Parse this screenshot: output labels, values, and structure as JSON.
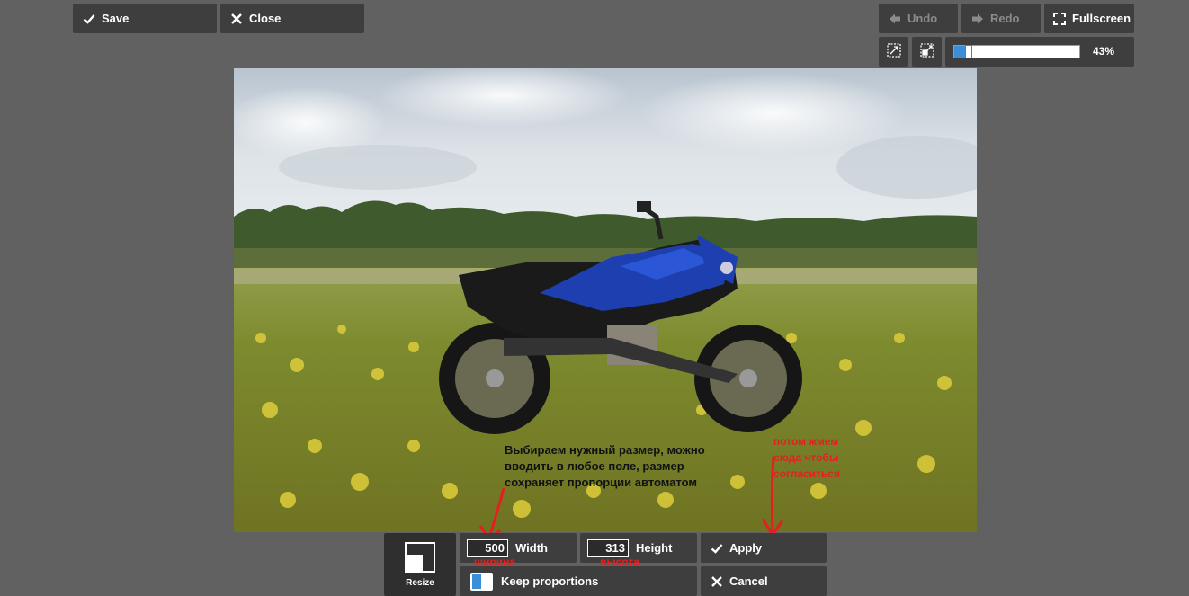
{
  "toolbar": {
    "save_label": "Save",
    "close_label": "Close",
    "undo_label": "Undo",
    "redo_label": "Redo",
    "fullscreen_label": "Fullscreen",
    "zoom_value": "43%",
    "zoom_fraction": 0.43
  },
  "annotations": {
    "note_main": "Выбираем нужный размер, можно вводить в любое поле, размер сохраняет пропорции автоматом",
    "note_apply": "потом жмем сюда чтобы согласиться",
    "note_width": "ширина",
    "note_height": "высота"
  },
  "resize_panel": {
    "tool_label": "Resize",
    "width_value": "500",
    "width_label": "Width",
    "height_value": "313",
    "height_label": "Height",
    "apply_label": "Apply",
    "keep_label": "Keep proportions",
    "cancel_label": "Cancel"
  },
  "colors": {
    "background": "#616161",
    "button": "#3e3e3e",
    "accent": "#3a8fd8",
    "annotation_red": "#e32020"
  },
  "icons": {
    "save": "check-icon",
    "close": "x-icon",
    "undo": "arrow-left-icon",
    "redo": "arrow-right-icon",
    "fullscreen": "expand-icon",
    "apply": "check-icon",
    "cancel": "x-icon"
  }
}
